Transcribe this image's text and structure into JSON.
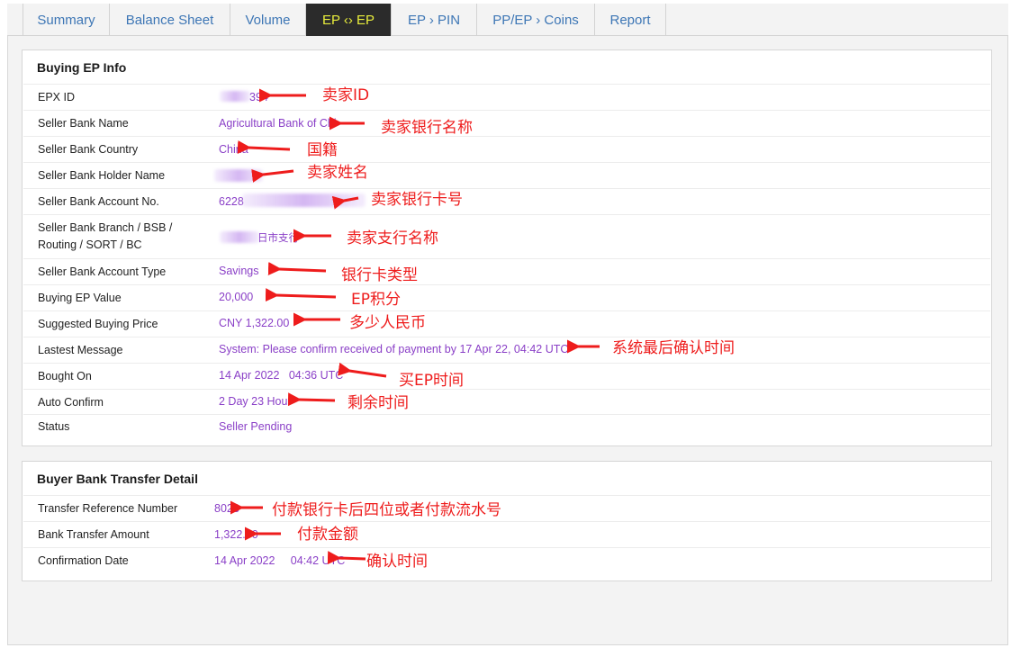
{
  "tabs": [
    {
      "label": "Summary"
    },
    {
      "label": "Balance Sheet"
    },
    {
      "label": "Volume"
    },
    {
      "label": "EP ‹› EP",
      "active": true
    },
    {
      "label": "EP › PIN"
    },
    {
      "label": "PP/EP › Coins"
    },
    {
      "label": "Report"
    }
  ],
  "buying": {
    "title": "Buying EP Info",
    "rows": [
      {
        "label": "EPX ID",
        "value": "394"
      },
      {
        "label": "Seller Bank Name",
        "value": "Agricultural Bank of Chi"
      },
      {
        "label": "Seller Bank Country",
        "value": "China"
      },
      {
        "label": "Seller Bank Holder Name",
        "value": ""
      },
      {
        "label": "Seller Bank Account No.",
        "value": "6228"
      },
      {
        "label": "Seller Bank Branch / BSB / Routing / SORT / BC",
        "value": "日市支行"
      },
      {
        "label": "Seller Bank Account Type",
        "value": "Savings"
      },
      {
        "label": "Buying EP Value",
        "value": "20,000"
      },
      {
        "label": "Suggested Buying Price",
        "value": "CNY 1,322.00"
      },
      {
        "label": "Lastest Message",
        "value": "System: Please confirm received of payment by 17 Apr 22, 04:42 UTC"
      },
      {
        "label": "Bought On",
        "value": "14 Apr 2022   04:36 UTC"
      },
      {
        "label": "Auto Confirm",
        "value": "2 Day 23 Hour"
      },
      {
        "label": "Status",
        "value": "Seller Pending"
      }
    ]
  },
  "transfer": {
    "title": "Buyer Bank Transfer Detail",
    "rows": [
      {
        "label": "Transfer Reference Number",
        "value": "8023"
      },
      {
        "label": "Bank Transfer Amount",
        "value": "1,322.00"
      },
      {
        "label": "Confirmation Date",
        "value": "14 Apr 2022     04:42 UTC"
      }
    ]
  },
  "annotations": [
    "卖家ID",
    "卖家银行名称",
    "国籍",
    "卖家姓名",
    "卖家银行卡号",
    "卖家支行名称",
    "银行卡类型",
    "EP积分",
    "多少人民币",
    "系统最后确认时间",
    "买EP时间",
    "剩余时间",
    "付款银行卡后四位或者付款流水号",
    "付款金额",
    "确认时间"
  ],
  "colors": {
    "value_text": "#8a3fc7",
    "tab_text": "#3d76b5",
    "active_tab_bg": "#2b2b2b",
    "active_tab_text": "#e9ee3c",
    "annotation": "#ee1c1c"
  }
}
